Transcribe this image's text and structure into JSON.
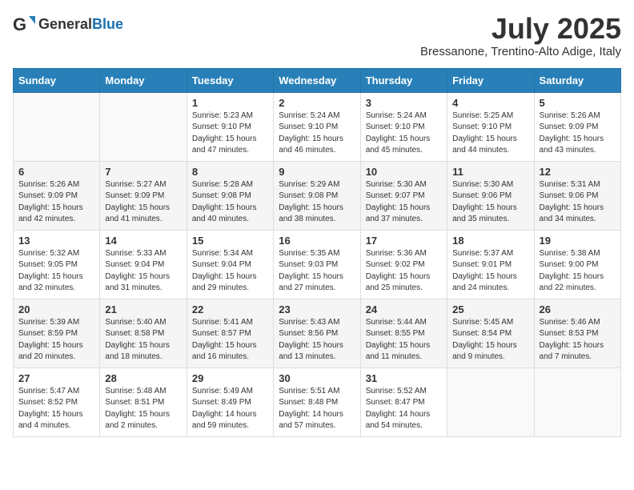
{
  "header": {
    "logo_general": "General",
    "logo_blue": "Blue",
    "month": "July 2025",
    "location": "Bressanone, Trentino-Alto Adige, Italy"
  },
  "days_of_week": [
    "Sunday",
    "Monday",
    "Tuesday",
    "Wednesday",
    "Thursday",
    "Friday",
    "Saturday"
  ],
  "weeks": [
    [
      {
        "day": "",
        "sunrise": "",
        "sunset": "",
        "daylight": ""
      },
      {
        "day": "",
        "sunrise": "",
        "sunset": "",
        "daylight": ""
      },
      {
        "day": "1",
        "sunrise": "Sunrise: 5:23 AM",
        "sunset": "Sunset: 9:10 PM",
        "daylight": "Daylight: 15 hours and 47 minutes."
      },
      {
        "day": "2",
        "sunrise": "Sunrise: 5:24 AM",
        "sunset": "Sunset: 9:10 PM",
        "daylight": "Daylight: 15 hours and 46 minutes."
      },
      {
        "day": "3",
        "sunrise": "Sunrise: 5:24 AM",
        "sunset": "Sunset: 9:10 PM",
        "daylight": "Daylight: 15 hours and 45 minutes."
      },
      {
        "day": "4",
        "sunrise": "Sunrise: 5:25 AM",
        "sunset": "Sunset: 9:10 PM",
        "daylight": "Daylight: 15 hours and 44 minutes."
      },
      {
        "day": "5",
        "sunrise": "Sunrise: 5:26 AM",
        "sunset": "Sunset: 9:09 PM",
        "daylight": "Daylight: 15 hours and 43 minutes."
      }
    ],
    [
      {
        "day": "6",
        "sunrise": "Sunrise: 5:26 AM",
        "sunset": "Sunset: 9:09 PM",
        "daylight": "Daylight: 15 hours and 42 minutes."
      },
      {
        "day": "7",
        "sunrise": "Sunrise: 5:27 AM",
        "sunset": "Sunset: 9:09 PM",
        "daylight": "Daylight: 15 hours and 41 minutes."
      },
      {
        "day": "8",
        "sunrise": "Sunrise: 5:28 AM",
        "sunset": "Sunset: 9:08 PM",
        "daylight": "Daylight: 15 hours and 40 minutes."
      },
      {
        "day": "9",
        "sunrise": "Sunrise: 5:29 AM",
        "sunset": "Sunset: 9:08 PM",
        "daylight": "Daylight: 15 hours and 38 minutes."
      },
      {
        "day": "10",
        "sunrise": "Sunrise: 5:30 AM",
        "sunset": "Sunset: 9:07 PM",
        "daylight": "Daylight: 15 hours and 37 minutes."
      },
      {
        "day": "11",
        "sunrise": "Sunrise: 5:30 AM",
        "sunset": "Sunset: 9:06 PM",
        "daylight": "Daylight: 15 hours and 35 minutes."
      },
      {
        "day": "12",
        "sunrise": "Sunrise: 5:31 AM",
        "sunset": "Sunset: 9:06 PM",
        "daylight": "Daylight: 15 hours and 34 minutes."
      }
    ],
    [
      {
        "day": "13",
        "sunrise": "Sunrise: 5:32 AM",
        "sunset": "Sunset: 9:05 PM",
        "daylight": "Daylight: 15 hours and 32 minutes."
      },
      {
        "day": "14",
        "sunrise": "Sunrise: 5:33 AM",
        "sunset": "Sunset: 9:04 PM",
        "daylight": "Daylight: 15 hours and 31 minutes."
      },
      {
        "day": "15",
        "sunrise": "Sunrise: 5:34 AM",
        "sunset": "Sunset: 9:04 PM",
        "daylight": "Daylight: 15 hours and 29 minutes."
      },
      {
        "day": "16",
        "sunrise": "Sunrise: 5:35 AM",
        "sunset": "Sunset: 9:03 PM",
        "daylight": "Daylight: 15 hours and 27 minutes."
      },
      {
        "day": "17",
        "sunrise": "Sunrise: 5:36 AM",
        "sunset": "Sunset: 9:02 PM",
        "daylight": "Daylight: 15 hours and 25 minutes."
      },
      {
        "day": "18",
        "sunrise": "Sunrise: 5:37 AM",
        "sunset": "Sunset: 9:01 PM",
        "daylight": "Daylight: 15 hours and 24 minutes."
      },
      {
        "day": "19",
        "sunrise": "Sunrise: 5:38 AM",
        "sunset": "Sunset: 9:00 PM",
        "daylight": "Daylight: 15 hours and 22 minutes."
      }
    ],
    [
      {
        "day": "20",
        "sunrise": "Sunrise: 5:39 AM",
        "sunset": "Sunset: 8:59 PM",
        "daylight": "Daylight: 15 hours and 20 minutes."
      },
      {
        "day": "21",
        "sunrise": "Sunrise: 5:40 AM",
        "sunset": "Sunset: 8:58 PM",
        "daylight": "Daylight: 15 hours and 18 minutes."
      },
      {
        "day": "22",
        "sunrise": "Sunrise: 5:41 AM",
        "sunset": "Sunset: 8:57 PM",
        "daylight": "Daylight: 15 hours and 16 minutes."
      },
      {
        "day": "23",
        "sunrise": "Sunrise: 5:43 AM",
        "sunset": "Sunset: 8:56 PM",
        "daylight": "Daylight: 15 hours and 13 minutes."
      },
      {
        "day": "24",
        "sunrise": "Sunrise: 5:44 AM",
        "sunset": "Sunset: 8:55 PM",
        "daylight": "Daylight: 15 hours and 11 minutes."
      },
      {
        "day": "25",
        "sunrise": "Sunrise: 5:45 AM",
        "sunset": "Sunset: 8:54 PM",
        "daylight": "Daylight: 15 hours and 9 minutes."
      },
      {
        "day": "26",
        "sunrise": "Sunrise: 5:46 AM",
        "sunset": "Sunset: 8:53 PM",
        "daylight": "Daylight: 15 hours and 7 minutes."
      }
    ],
    [
      {
        "day": "27",
        "sunrise": "Sunrise: 5:47 AM",
        "sunset": "Sunset: 8:52 PM",
        "daylight": "Daylight: 15 hours and 4 minutes."
      },
      {
        "day": "28",
        "sunrise": "Sunrise: 5:48 AM",
        "sunset": "Sunset: 8:51 PM",
        "daylight": "Daylight: 15 hours and 2 minutes."
      },
      {
        "day": "29",
        "sunrise": "Sunrise: 5:49 AM",
        "sunset": "Sunset: 8:49 PM",
        "daylight": "Daylight: 14 hours and 59 minutes."
      },
      {
        "day": "30",
        "sunrise": "Sunrise: 5:51 AM",
        "sunset": "Sunset: 8:48 PM",
        "daylight": "Daylight: 14 hours and 57 minutes."
      },
      {
        "day": "31",
        "sunrise": "Sunrise: 5:52 AM",
        "sunset": "Sunset: 8:47 PM",
        "daylight": "Daylight: 14 hours and 54 minutes."
      },
      {
        "day": "",
        "sunrise": "",
        "sunset": "",
        "daylight": ""
      },
      {
        "day": "",
        "sunrise": "",
        "sunset": "",
        "daylight": ""
      }
    ]
  ]
}
